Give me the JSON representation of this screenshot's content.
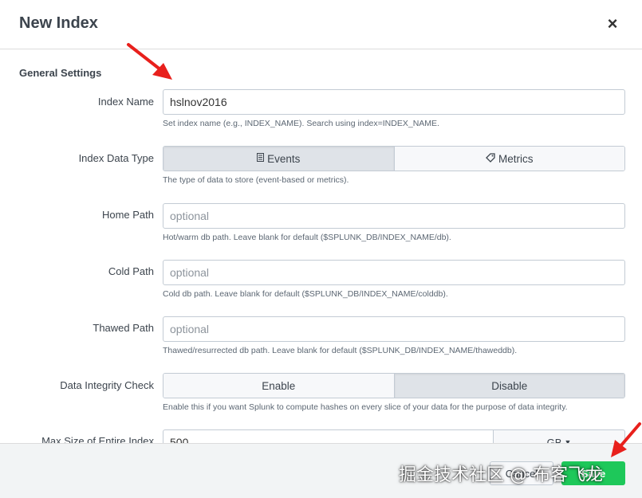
{
  "dialog": {
    "title": "New Index",
    "close_glyph": "×"
  },
  "section": {
    "title": "General Settings"
  },
  "fields": {
    "index_name": {
      "label": "Index Name",
      "value": "hslnov2016",
      "help": "Set index name (e.g., INDEX_NAME). Search using index=INDEX_NAME."
    },
    "data_type": {
      "label": "Index Data Type",
      "options": [
        "Events",
        "Metrics"
      ],
      "selected": "Events",
      "help": "The type of data to store (event-based or metrics)."
    },
    "home_path": {
      "label": "Home Path",
      "placeholder": "optional",
      "help": "Hot/warm db path. Leave blank for default ($SPLUNK_DB/INDEX_NAME/db)."
    },
    "cold_path": {
      "label": "Cold Path",
      "placeholder": "optional",
      "help": "Cold db path. Leave blank for default ($SPLUNK_DB/INDEX_NAME/colddb)."
    },
    "thawed_path": {
      "label": "Thawed Path",
      "placeholder": "optional",
      "help": "Thawed/resurrected db path. Leave blank for default ($SPLUNK_DB/INDEX_NAME/thaweddb)."
    },
    "integrity": {
      "label": "Data Integrity Check",
      "options": [
        "Enable",
        "Disable"
      ],
      "selected": "Disable",
      "help": "Enable this if you want Splunk to compute hashes on every slice of your data for the purpose of data integrity."
    },
    "max_size": {
      "label": "Max Size of Entire Index",
      "value": "500",
      "unit": "GB"
    }
  },
  "footer": {
    "cancel_label": "Cancel",
    "save_label": "Save"
  },
  "watermark": "掘金技术社区 @ 布客飞龙",
  "colors": {
    "accent_green": "#1ec85a",
    "annotation_red": "#e8201c"
  },
  "icons": {
    "events": "list-icon",
    "metrics": "tag-icon",
    "caret": "caret-down-icon"
  }
}
